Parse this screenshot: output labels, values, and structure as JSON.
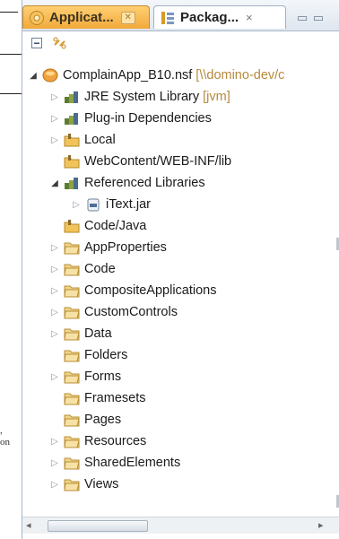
{
  "tabs": [
    {
      "label": "Applicat...",
      "close": "✕",
      "icon": "applications-icon"
    },
    {
      "label": "Packag...",
      "close": "×",
      "icon": "package-explorer-icon"
    }
  ],
  "view_controls": "▭ ▭",
  "left_caption": [
    ",",
    "on"
  ],
  "tree": [
    {
      "label": "ComplainApp_B10.nsf",
      "deco": "[\\\\domino-dev/c",
      "icon": "nsf-db-icon",
      "twisty": "open",
      "indent": 0
    },
    {
      "label": "JRE System Library",
      "deco": "[jvm]",
      "icon": "library-icon",
      "twisty": "closed",
      "indent": 1
    },
    {
      "label": "Plug-in Dependencies",
      "deco": "",
      "icon": "library-icon",
      "twisty": "closed",
      "indent": 1
    },
    {
      "label": "Local",
      "deco": "",
      "icon": "source-folder-icon",
      "twisty": "closed",
      "indent": 1
    },
    {
      "label": "WebContent/WEB-INF/lib",
      "deco": "",
      "icon": "source-folder-icon",
      "twisty": "none",
      "indent": 1
    },
    {
      "label": "Referenced Libraries",
      "deco": "",
      "icon": "library-icon",
      "twisty": "open",
      "indent": 1
    },
    {
      "label": "iText.jar",
      "deco": "",
      "icon": "jar-icon",
      "twisty": "closed",
      "indent": 2
    },
    {
      "label": "Code/Java",
      "deco": "",
      "icon": "source-folder-icon",
      "twisty": "none",
      "indent": 1
    },
    {
      "label": "AppProperties",
      "deco": "",
      "icon": "folder-icon",
      "twisty": "closed",
      "indent": 1
    },
    {
      "label": "Code",
      "deco": "",
      "icon": "folder-icon",
      "twisty": "closed",
      "indent": 1
    },
    {
      "label": "CompositeApplications",
      "deco": "",
      "icon": "folder-icon",
      "twisty": "closed",
      "indent": 1
    },
    {
      "label": "CustomControls",
      "deco": "",
      "icon": "folder-icon",
      "twisty": "closed",
      "indent": 1
    },
    {
      "label": "Data",
      "deco": "",
      "icon": "folder-icon",
      "twisty": "closed",
      "indent": 1
    },
    {
      "label": "Folders",
      "deco": "",
      "icon": "folder-icon",
      "twisty": "none",
      "indent": 1
    },
    {
      "label": "Forms",
      "deco": "",
      "icon": "folder-icon",
      "twisty": "closed",
      "indent": 1
    },
    {
      "label": "Framesets",
      "deco": "",
      "icon": "folder-icon",
      "twisty": "none",
      "indent": 1
    },
    {
      "label": "Pages",
      "deco": "",
      "icon": "folder-icon",
      "twisty": "none",
      "indent": 1
    },
    {
      "label": "Resources",
      "deco": "",
      "icon": "folder-icon",
      "twisty": "closed",
      "indent": 1
    },
    {
      "label": "SharedElements",
      "deco": "",
      "icon": "folder-icon",
      "twisty": "closed",
      "indent": 1
    },
    {
      "label": "Views",
      "deco": "",
      "icon": "folder-icon",
      "twisty": "closed",
      "indent": 1
    }
  ],
  "colors": {
    "active_tab_bg": "#ffffff",
    "inactive_tab_bg": "#f1a93a",
    "folder": "#e9b44c",
    "library": "#7a8b3a"
  }
}
